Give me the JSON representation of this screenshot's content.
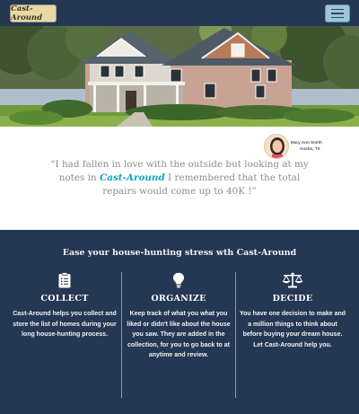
{
  "navbar": {
    "brand": "Cast-Around",
    "menu_icon": "hamburger-menu-icon"
  },
  "hero": {
    "image": "house-photo"
  },
  "testimonial": {
    "author_name": "Mary Ann Smith",
    "author_location": "Austin, TX",
    "quote_before": "“I had fallen in love with the outside but looking at my notes in ",
    "quote_brand": "Cast-Around",
    "quote_after": " I remembered that the total repairs would come up to 40K !”"
  },
  "features": {
    "heading": "Ease your house-hunting stress wth Cast-Around",
    "columns": [
      {
        "icon": "clipboard-list-icon",
        "title": "COLLECT",
        "text": "Cast-Around helps you collect and store the list of homes during your long house-hunting process."
      },
      {
        "icon": "lightbulb-icon",
        "title": "ORGANIZE",
        "text": "Keep track of what you what you liked or didn't like about the house you saw. They are added in the collection, for you to go back to at anytime and review."
      },
      {
        "icon": "balance-scale-icon",
        "title": "DECIDE",
        "text": "You have one decision to make and a million things to think about before buying your dream house. Let Cast-Around help you."
      }
    ]
  }
}
